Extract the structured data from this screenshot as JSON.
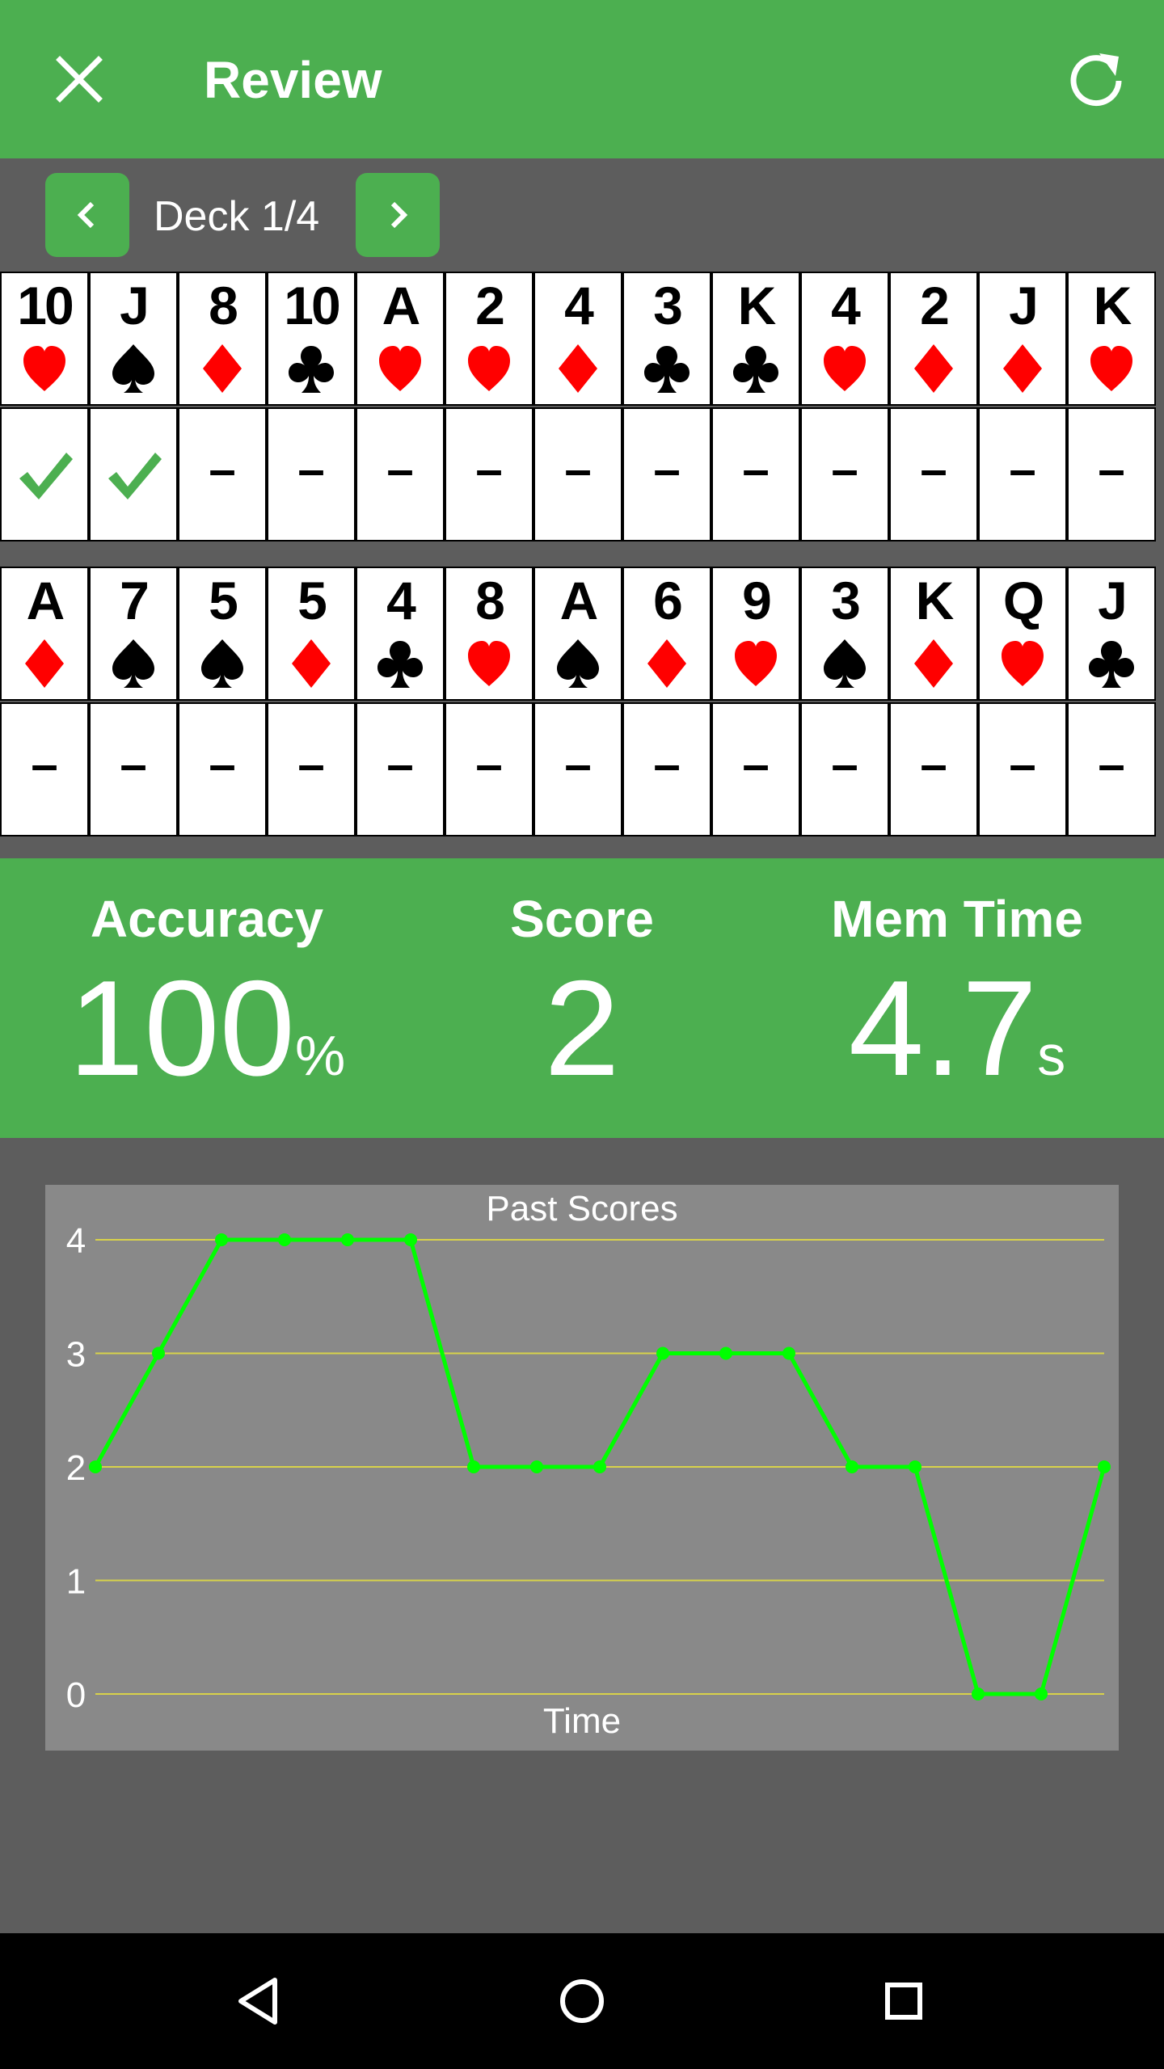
{
  "appbar": {
    "title": "Review",
    "close_icon": "close-icon",
    "refresh_icon": "refresh-icon"
  },
  "deck_nav": {
    "label": "Deck 1/4",
    "prev_icon": "chevron-left-icon",
    "next_icon": "chevron-right-icon"
  },
  "row1": {
    "cards": [
      {
        "rank": "10",
        "suit": "hearts"
      },
      {
        "rank": "J",
        "suit": "spades"
      },
      {
        "rank": "8",
        "suit": "diamonds"
      },
      {
        "rank": "10",
        "suit": "clubs"
      },
      {
        "rank": "A",
        "suit": "hearts"
      },
      {
        "rank": "2",
        "suit": "hearts"
      },
      {
        "rank": "4",
        "suit": "diamonds"
      },
      {
        "rank": "3",
        "suit": "clubs"
      },
      {
        "rank": "K",
        "suit": "clubs"
      },
      {
        "rank": "4",
        "suit": "hearts"
      },
      {
        "rank": "2",
        "suit": "diamonds"
      },
      {
        "rank": "J",
        "suit": "diamonds"
      },
      {
        "rank": "K",
        "suit": "hearts"
      }
    ],
    "answers": [
      "correct",
      "correct",
      "–",
      "–",
      "–",
      "–",
      "–",
      "–",
      "–",
      "–",
      "–",
      "–",
      "–"
    ]
  },
  "row2": {
    "cards": [
      {
        "rank": "A",
        "suit": "diamonds"
      },
      {
        "rank": "7",
        "suit": "spades"
      },
      {
        "rank": "5",
        "suit": "spades"
      },
      {
        "rank": "5",
        "suit": "diamonds"
      },
      {
        "rank": "4",
        "suit": "clubs"
      },
      {
        "rank": "8",
        "suit": "hearts"
      },
      {
        "rank": "A",
        "suit": "spades"
      },
      {
        "rank": "6",
        "suit": "diamonds"
      },
      {
        "rank": "9",
        "suit": "hearts"
      },
      {
        "rank": "3",
        "suit": "spades"
      },
      {
        "rank": "K",
        "suit": "diamonds"
      },
      {
        "rank": "Q",
        "suit": "hearts"
      },
      {
        "rank": "J",
        "suit": "clubs"
      }
    ],
    "answers": [
      "–",
      "–",
      "–",
      "–",
      "–",
      "–",
      "–",
      "–",
      "–",
      "–",
      "–",
      "–",
      "–"
    ]
  },
  "stats": {
    "accuracy": {
      "label": "Accuracy",
      "value": "100",
      "unit": "%"
    },
    "score": {
      "label": "Score",
      "value": "2",
      "unit": ""
    },
    "mem_time": {
      "label": "Mem Time",
      "value": "4.7",
      "unit": "s"
    }
  },
  "chart_data": {
    "type": "line",
    "title": "Past Scores",
    "xlabel": "Time",
    "ylabel": "",
    "ylim": [
      0,
      4
    ],
    "yticks": [
      "0",
      "1",
      "2",
      "3",
      "4"
    ],
    "grid": true,
    "series": [
      {
        "values": [
          2,
          3,
          4,
          4,
          4,
          4,
          2,
          2,
          2,
          3,
          3,
          3,
          2,
          2,
          0,
          0,
          2
        ]
      }
    ]
  },
  "colors": {
    "accent": "#4caf50",
    "background": "#5d5d5d",
    "chart_bg": "#898989",
    "line": "#00ff00",
    "gridline": "#d8d24a",
    "red_suit": "#ff0000",
    "black_suit": "#000000",
    "check": "#4caf50"
  },
  "system_nav": {
    "back_icon": "back-triangle-icon",
    "home_icon": "home-circle-icon",
    "recents_icon": "recents-square-icon"
  }
}
